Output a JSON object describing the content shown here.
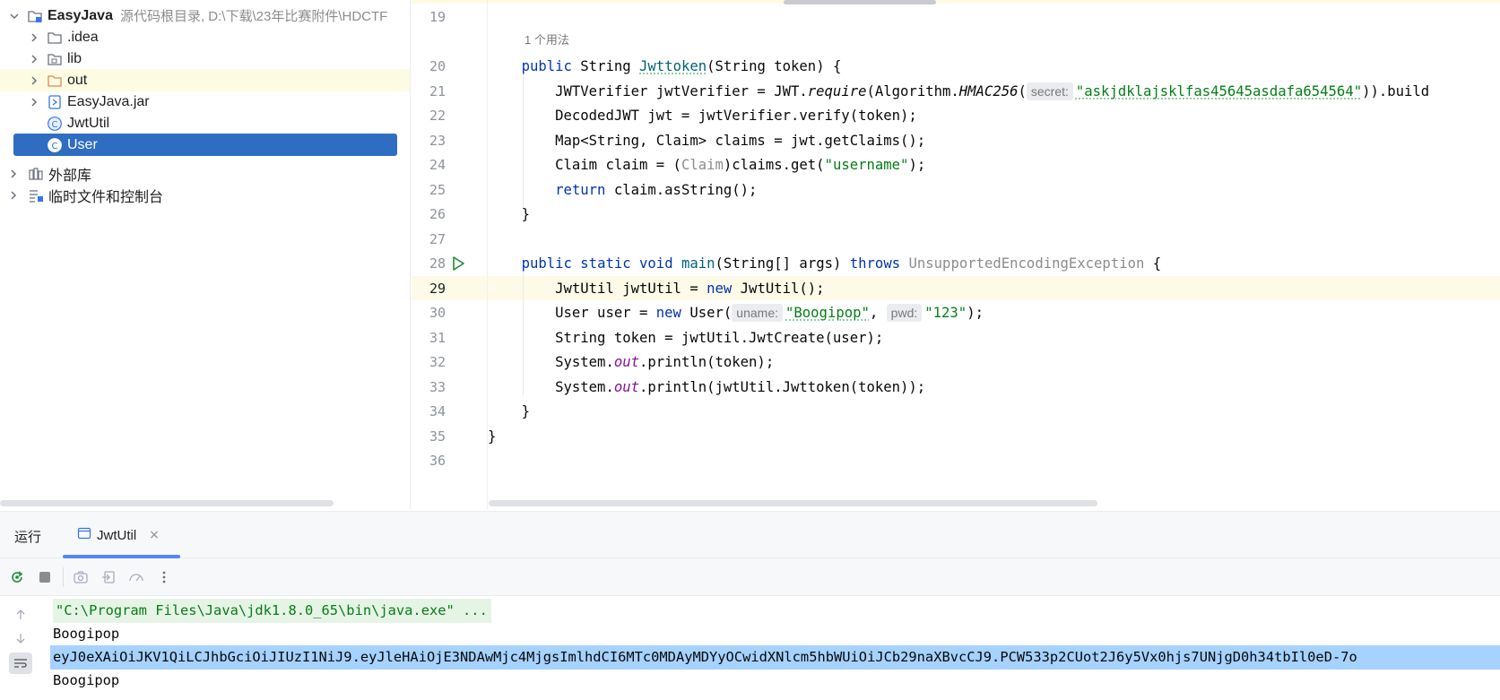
{
  "project": {
    "root": {
      "label": "EasyJava",
      "path": "源代码根目录, D:\\下载\\23年比赛附件\\HDCTF"
    },
    "items": [
      {
        "label": ".idea",
        "icon": "folder-icon"
      },
      {
        "label": "lib",
        "icon": "library-folder-icon"
      },
      {
        "label": "out",
        "icon": "excluded-folder-icon"
      },
      {
        "label": "EasyJava.jar",
        "icon": "jar-icon"
      },
      {
        "label": "JwtUtil",
        "icon": "class-icon"
      },
      {
        "label": "User",
        "icon": "class-icon",
        "selected": true
      }
    ],
    "external": {
      "label": "外部库"
    },
    "scratches": {
      "label": "临时文件和控制台"
    }
  },
  "editor": {
    "usage_hint": "1 个用法",
    "line_numbers": [
      "19",
      "20",
      "21",
      "22",
      "23",
      "24",
      "25",
      "26",
      "27",
      "28",
      "29",
      "30",
      "31",
      "32",
      "33",
      "34",
      "35",
      "36"
    ],
    "code": {
      "l20": {
        "kw": "public",
        "type": "String",
        "name": "Jwttoken",
        "rest": "(String token) {"
      },
      "l21": {
        "pre": "JWTVerifier jwtVerifier = JWT.",
        "call": "require",
        "mid": "(Algorithm.",
        "const": "HMAC256",
        "open": "(",
        "hint": "secret:",
        "str": "\"askjdklajsklfas45645asdafa654564\"",
        "post": ")).build"
      },
      "l22": "DecodedJWT jwt = jwtVerifier.verify(token);",
      "l23": "Map<String, Claim> claims = jwt.getClaims();",
      "l24": {
        "pre": "Claim claim = (",
        "cast": "Claim",
        "mid": ")claims.get(",
        "str": "\"username\"",
        "post": ");"
      },
      "l25": {
        "kw": "return",
        "rest": " claim.asString();"
      },
      "l26": "}",
      "l28": {
        "kw1": "public",
        "kw2": "static",
        "kw3": "void",
        "name": "main",
        "mid": "(String[] args) ",
        "kw4": "throws",
        "exc": "UnsupportedEncodingException",
        "post": " {"
      },
      "l29": {
        "pre": "JwtUtil jwtUtil = ",
        "kw": "new",
        "post": " JwtUtil();"
      },
      "l30": {
        "pre": "User user = ",
        "kw": "new",
        "mid": " User(",
        "hint1": "uname:",
        "str1": "\"Boogipop\"",
        "sep": ", ",
        "hint2": "pwd:",
        "str2": "\"123\"",
        "post": ");"
      },
      "l31": "String token = jwtUtil.JwtCreate(user);",
      "l32": {
        "pre": "System.",
        "field": "out",
        "post": ".println(token);"
      },
      "l33": {
        "pre": "System.",
        "field": "out",
        "post": ".println(jwtUtil.Jwttoken(token));"
      },
      "l34": "}",
      "l35": "}"
    }
  },
  "run": {
    "title": "运行",
    "tab": {
      "label": "JwtUtil",
      "close": "×"
    },
    "console": [
      "\"C:\\Program Files\\Java\\jdk1.8.0_65\\bin\\java.exe\" ...",
      "Boogipop",
      "eyJ0eXAiOiJKV1QiLCJhbGciOiJIUzI1NiJ9.eyJleHAiOjE3NDAwMjc4MjgsImlhdCI6MTc0MDAyMDYyOCwidXNlcm5hbWUiOiJCb29naXBvcCJ9.PCW533p2CUot2J6y5Vx0hjs7UNjgD0h34tbIl0eD-7o",
      "Boogipop"
    ]
  },
  "colors": {
    "selection": "#2f6dc3",
    "keyword": "#0033b3",
    "string": "#067d17",
    "accent": "#3574f0"
  }
}
